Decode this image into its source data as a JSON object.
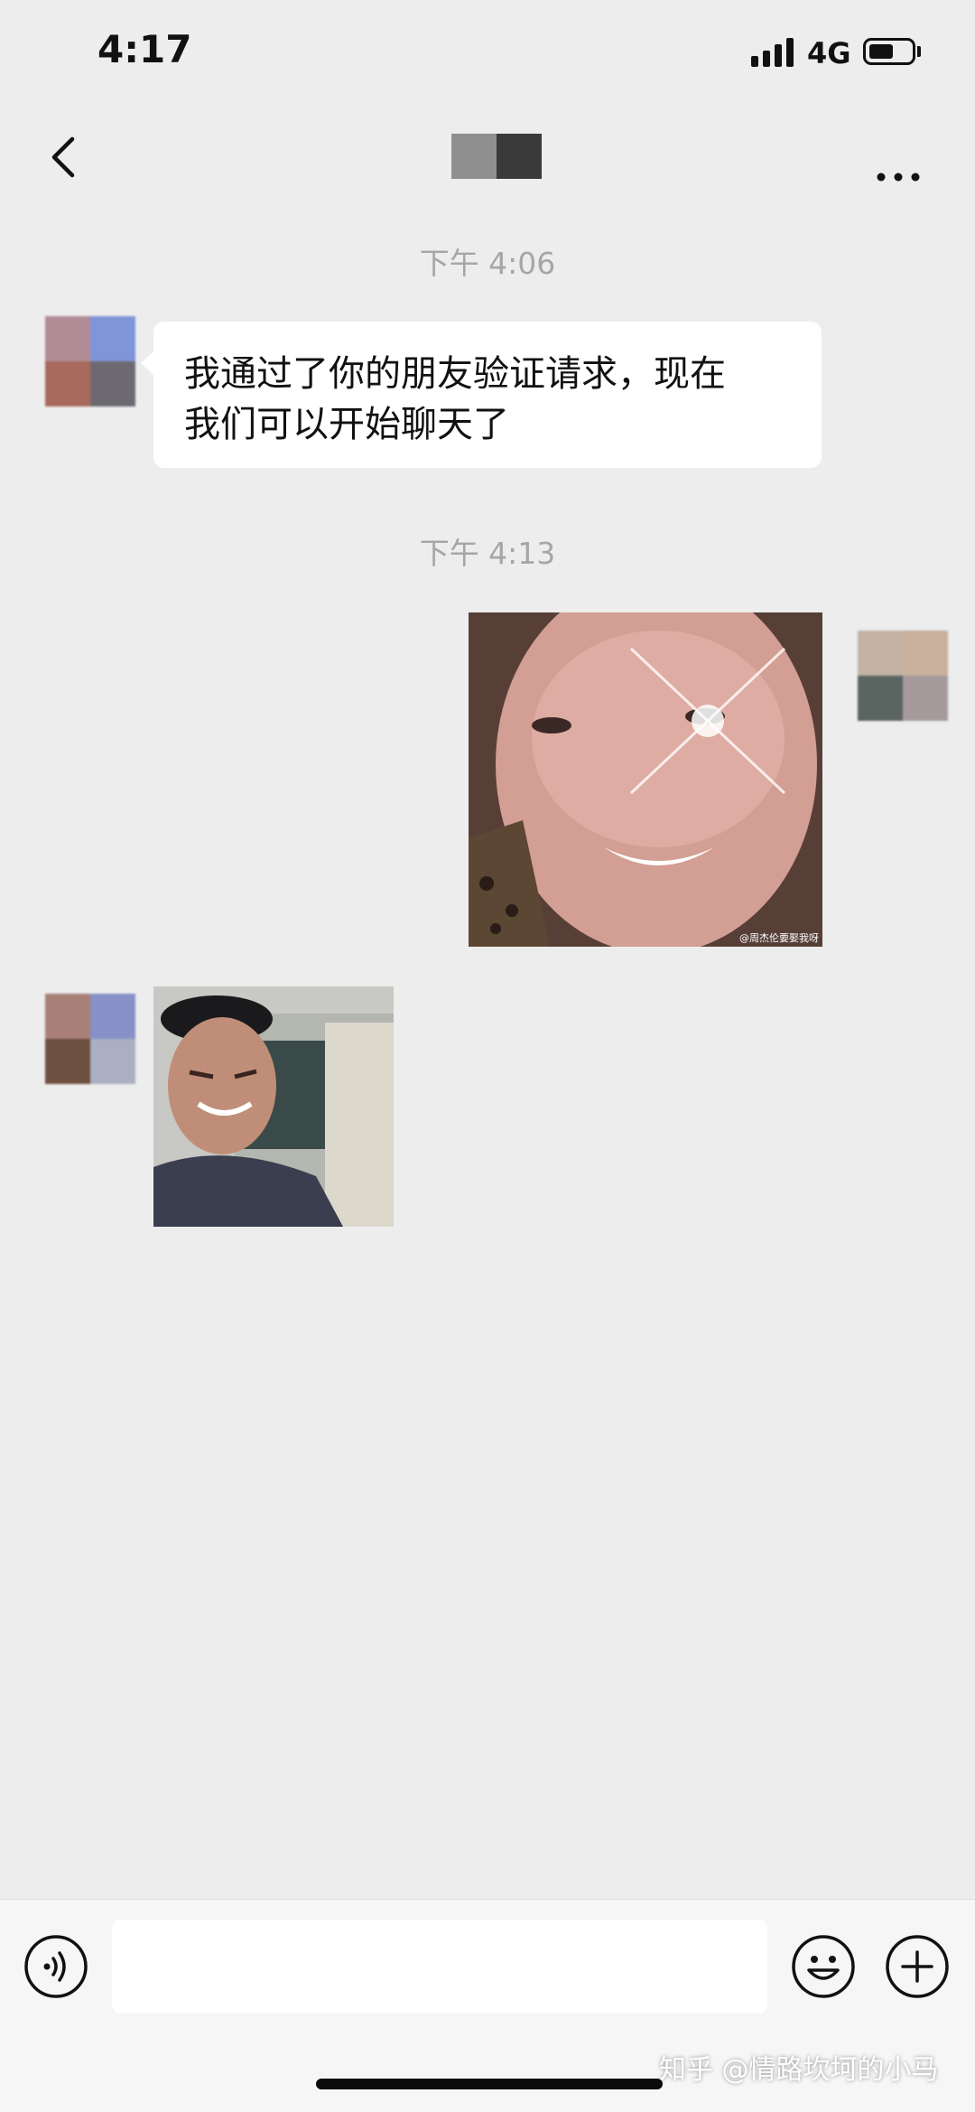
{
  "status_bar": {
    "time": "4:17",
    "network": "4G",
    "battery_icon": "battery-icon",
    "signal_icon": "signal-bars-icon"
  },
  "nav_bar": {
    "back_icon": "chevron-left-icon",
    "more_icon": "more-dots-icon",
    "title_redacted": true
  },
  "messages": [
    {
      "type": "timestamp",
      "text": "下午 4:06"
    },
    {
      "type": "text",
      "side": "left",
      "lines": [
        "我通过了你的朋友验证请求，现在",
        "我们可以开始聊天了"
      ]
    },
    {
      "type": "timestamp",
      "text": "下午 4:13"
    },
    {
      "type": "image",
      "side": "right",
      "caption": "@周杰伦要娶我呀"
    },
    {
      "type": "image",
      "side": "left"
    }
  ],
  "input_bar": {
    "voice_icon": "voice-icon",
    "emoji_icon": "emoji-icon",
    "add_icon": "plus-circle-icon"
  },
  "watermark": "知乎 @情路坎坷的小马",
  "colors": {
    "background": "#ededed",
    "bubble": "#ffffff",
    "timestamp": "#a6a6a6",
    "input_bar": "#f6f6f6"
  }
}
